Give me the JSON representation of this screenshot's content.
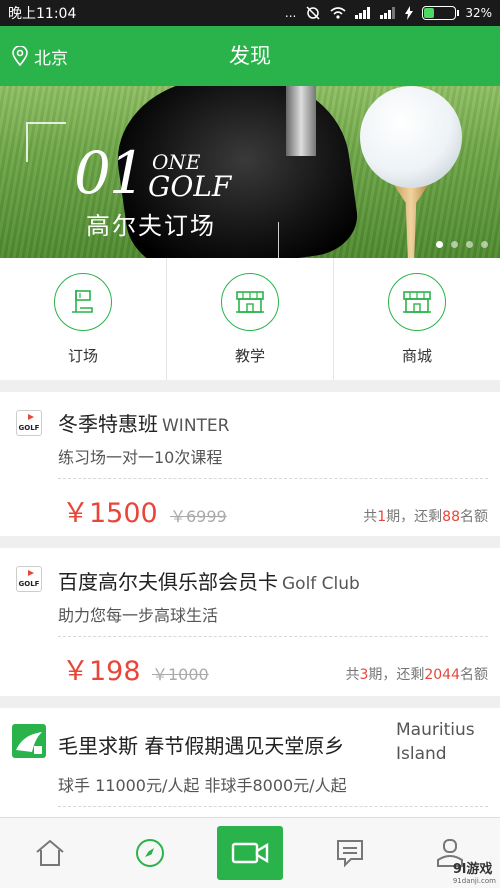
{
  "status_bar": {
    "time": "晚上11:04",
    "dots": "...",
    "battery_percent": "32%",
    "battery_level": 0.32
  },
  "header": {
    "location": "北京",
    "title": "发现"
  },
  "banner": {
    "number": "01",
    "one": "ONE",
    "golf": "GOLF",
    "caption": "高尔夫订场",
    "slides": 4,
    "active_slide": 0
  },
  "categories": [
    {
      "label": "订场",
      "icon": "flag-icon"
    },
    {
      "label": "教学",
      "icon": "shop-icon"
    },
    {
      "label": "商城",
      "icon": "store-icon"
    }
  ],
  "cards": [
    {
      "logo": "golf-logo",
      "logo_text": "GOLF",
      "name": "冬季特惠班",
      "name_en": "WINTER",
      "subtitle": "练习场一对一10次课程",
      "price": "￥1500",
      "original_price": "￥6999",
      "stock_prefix": "共",
      "periods": "1",
      "stock_mid": "期，还剩",
      "remaining": "88",
      "stock_suffix": "名额"
    },
    {
      "logo": "golf-logo",
      "logo_text": "GOLF",
      "name": "百度高尔夫俱乐部会员卡",
      "name_en": "Golf Club",
      "subtitle": "助力您每一步高球生活",
      "price": "￥198",
      "original_price": "￥1000",
      "stock_prefix": "共",
      "periods": "3",
      "stock_mid": "期，还剩",
      "remaining": "2044",
      "stock_suffix": "名额"
    },
    {
      "logo": "island-logo",
      "name": "毛里求斯 春节假期遇见天堂原乡",
      "name_en_1": "Mauritius",
      "name_en_2": "Island",
      "subtitle": "球手 11000元/人起  非球手8000元/人起"
    }
  ],
  "bottom_nav": [
    {
      "icon": "home-icon"
    },
    {
      "icon": "compass-icon"
    },
    {
      "icon": "video-camera-icon",
      "active": true
    },
    {
      "icon": "message-icon"
    },
    {
      "icon": "profile-icon"
    }
  ],
  "watermark": {
    "text": "9l游戏",
    "sub": "91danji.com"
  },
  "colors": {
    "brand_green": "#2ab34a",
    "price_red": "#e8463a"
  }
}
